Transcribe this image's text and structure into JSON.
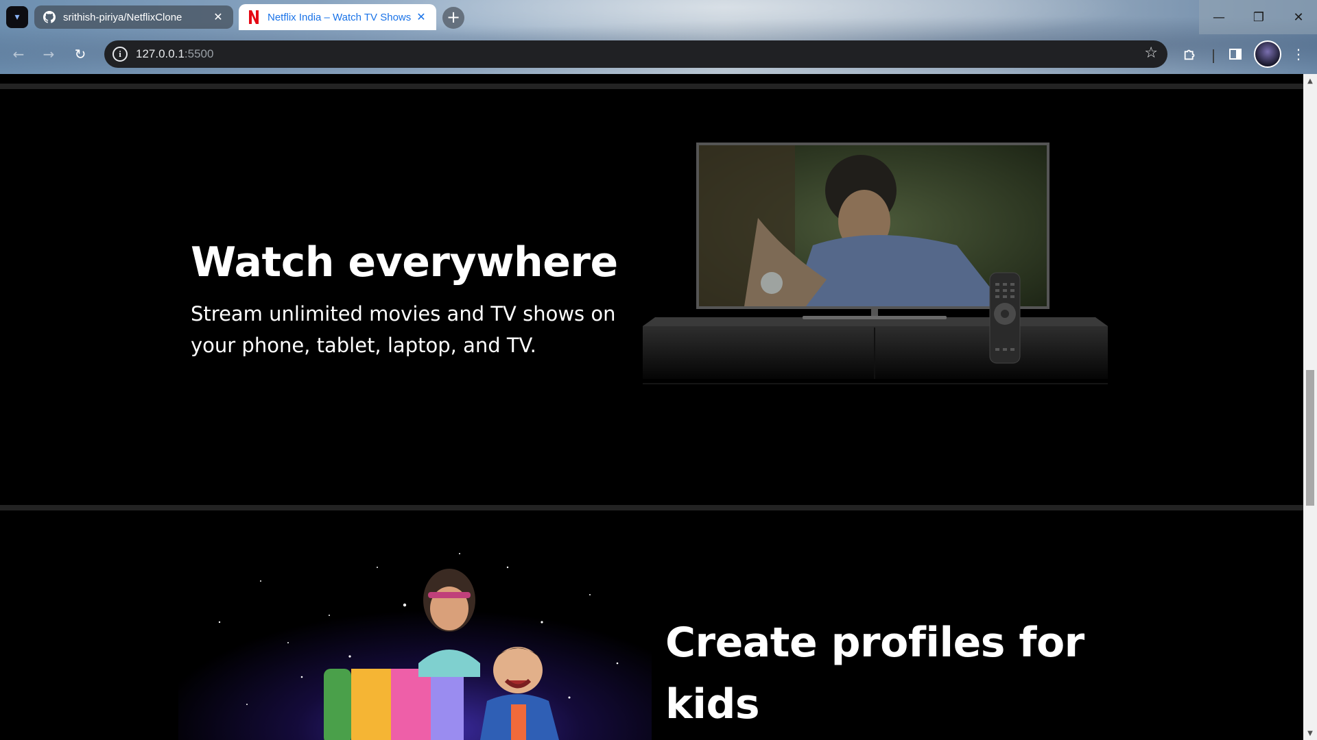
{
  "browser": {
    "tabs": [
      {
        "title": "srithish-piriya/NetflixClone",
        "icon": "github-icon",
        "active": false
      },
      {
        "title": "Netflix India – Watch TV Shows",
        "icon": "netflix-icon",
        "active": true
      }
    ],
    "url_host": "127.0.0.1",
    "url_port": ":5500",
    "window_controls": {
      "minimize": "—",
      "restore": "❐",
      "close": "✕"
    },
    "accent_color": "#1a73e8"
  },
  "sections": {
    "watch": {
      "title": "Watch everywhere",
      "description": "Stream unlimited movies and TV shows on your phone, tablet, laptop, and TV."
    },
    "kids": {
      "title": "Create profiles for kids"
    }
  },
  "colors": {
    "page_bg": "#000000",
    "divider": "#232323",
    "netflix_red": "#e50914"
  }
}
